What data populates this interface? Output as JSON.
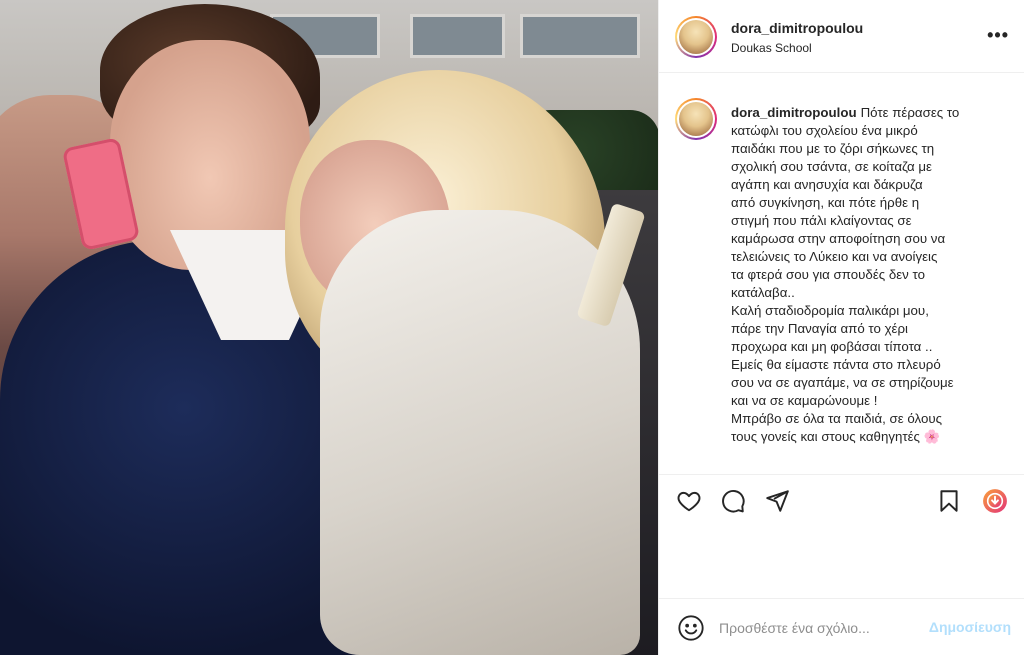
{
  "post": {
    "author": "dora_dimitropoulou",
    "location": "Doukas School",
    "more_icon": "more-horizontal-icon"
  },
  "caption": {
    "author": "dora_dimitropoulou",
    "lines": [
      "Πότε πέρασες το",
      "κατώφλι του σχολείου ένα μικρό",
      "παιδάκι που με το ζόρι σήκωνες τη",
      "σχολική σου τσάντα, σε κοίταζα με",
      "αγάπη και ανησυχία και δάκρυζα",
      "από συγκίνηση, και πότε ήρθε η",
      "στιγμή που πάλι κλαίγοντας σε",
      "καμάρωσα στην αποφοίτηση σου να",
      "τελειώνεις το Λύκειο και να ανοίγεις",
      "τα φτερά σου για σπουδές δεν το",
      "κατάλαβα..",
      "Καλή σταδιοδρομία παλικάρι μου,",
      "πάρε την Παναγία από το χέρι",
      "προχωρα και μη φοβάσαι τίποτα ..",
      "Εμείς θα είμαστε πάντα στο πλευρό",
      "σου να σε αγαπάμε, να σε στηρίζουμε",
      "και να σε καμαρώνουμε !",
      "Μπράβο σε όλα τα παιδιά, σε όλους",
      "τους γονείς και στους καθηγητές"
    ],
    "emoji": "🌸"
  },
  "actions": {
    "like": "heart-icon",
    "comment": "comment-icon",
    "share": "share-icon",
    "save": "bookmark-icon",
    "extension": "download-extension-icon"
  },
  "comment_bar": {
    "emoji_icon": "smiley-icon",
    "placeholder": "Προσθέστε ένα σχόλιο...",
    "post_label": "Δημοσίευση"
  },
  "colors": {
    "text": "#262626",
    "muted": "#8e8e8e",
    "post_disabled": "#b2dffc",
    "border": "#efefef"
  }
}
